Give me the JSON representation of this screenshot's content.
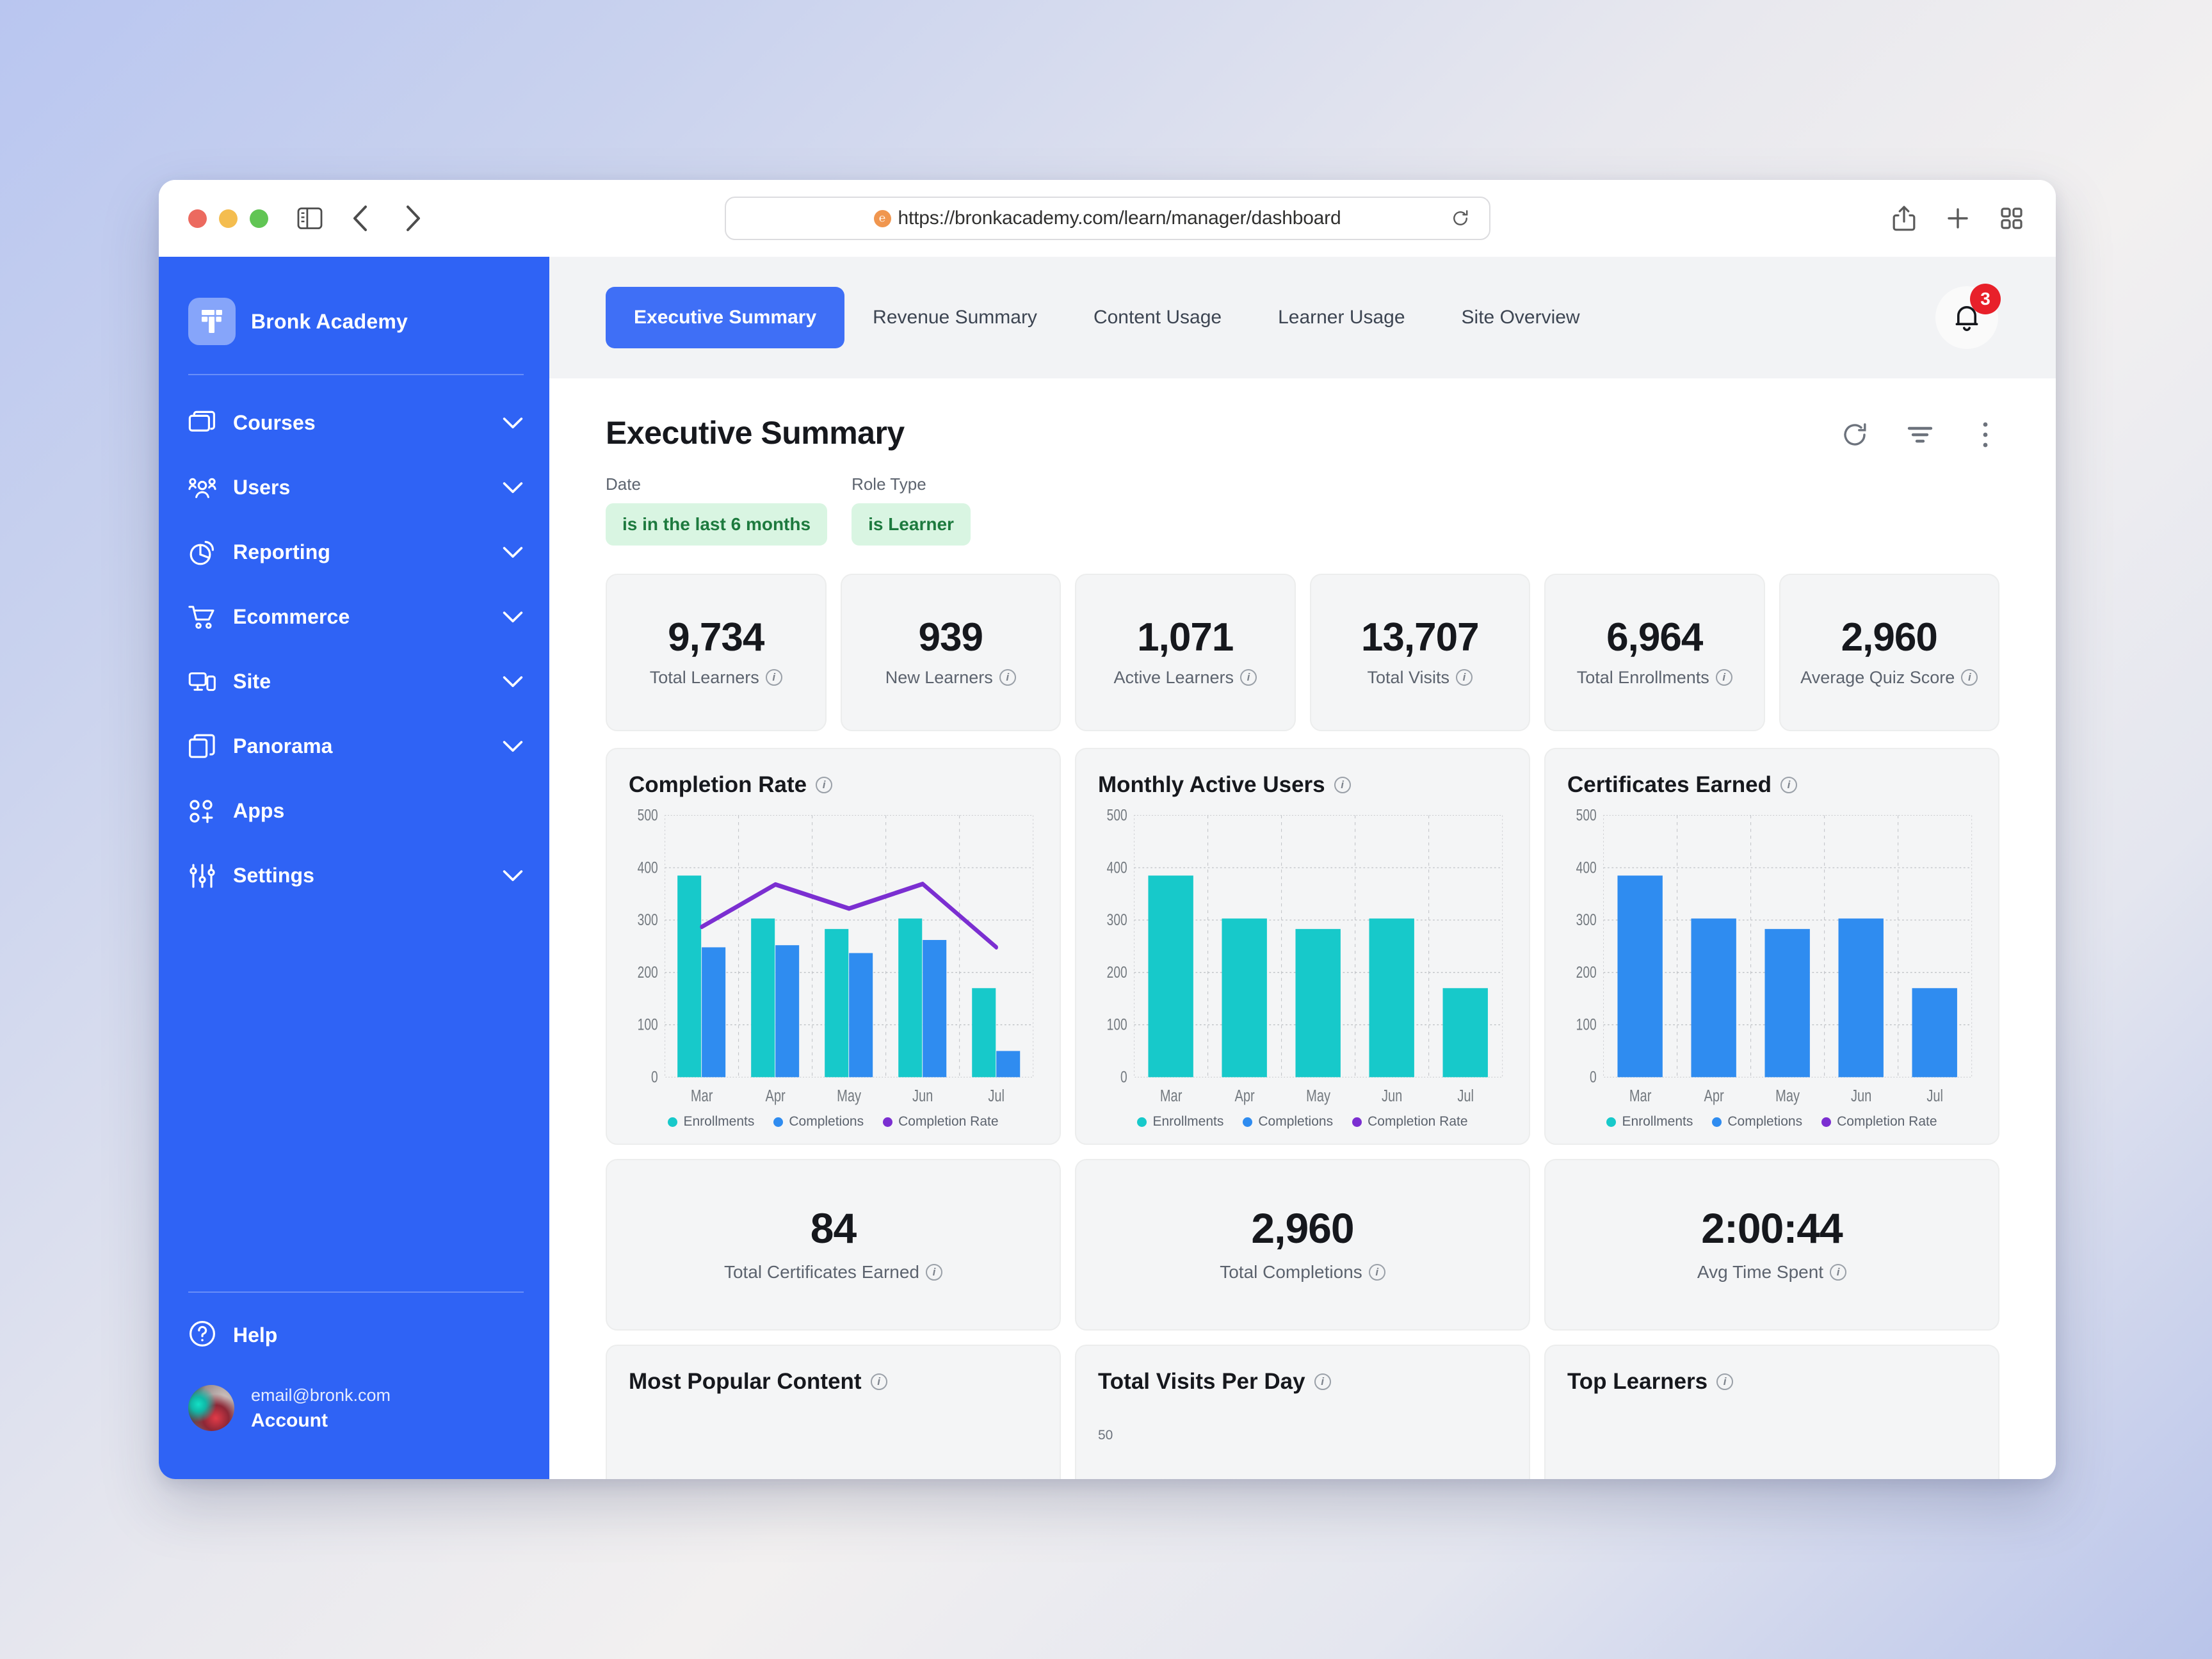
{
  "browser": {
    "url": "https://bronkacademy.com/learn/manager/dashboard",
    "favicon_icon": "orange-circle-favicon",
    "back_icon": "chevron-left-icon",
    "forward_icon": "chevron-right-icon",
    "sidebar_toggle_icon": "sidebar-toggle-icon",
    "reload_icon": "reload-icon",
    "share_icon": "share-icon",
    "new_tab_icon": "plus-icon",
    "tab_overview_icon": "grid-icon"
  },
  "sidebar": {
    "brand": "Bronk Academy",
    "brand_logo_icon": "bronk-logo-icon",
    "items": [
      {
        "label": "Courses",
        "icon": "courses-icon",
        "chevron": true
      },
      {
        "label": "Users",
        "icon": "users-icon",
        "chevron": true
      },
      {
        "label": "Reporting",
        "icon": "reporting-icon",
        "chevron": true
      },
      {
        "label": "Ecommerce",
        "icon": "cart-icon",
        "chevron": true
      },
      {
        "label": "Site",
        "icon": "site-icon",
        "chevron": true
      },
      {
        "label": "Panorama",
        "icon": "panorama-icon",
        "chevron": true
      },
      {
        "label": "Apps",
        "icon": "apps-icon",
        "chevron": false
      },
      {
        "label": "Settings",
        "icon": "settings-icon",
        "chevron": true
      }
    ],
    "help": {
      "label": "Help",
      "icon": "help-circle-icon"
    },
    "account": {
      "email": "email@bronk.com",
      "name": "Account",
      "avatar_icon": "user-avatar"
    }
  },
  "tabs": [
    {
      "label": "Executive Summary",
      "active": true
    },
    {
      "label": "Revenue Summary",
      "active": false
    },
    {
      "label": "Content Usage",
      "active": false
    },
    {
      "label": "Learner Usage",
      "active": false
    },
    {
      "label": "Site Overview",
      "active": false
    }
  ],
  "notifications": {
    "count": "3",
    "icon": "bell-icon"
  },
  "page": {
    "title": "Executive Summary",
    "actions": [
      {
        "name": "refresh-button",
        "icon": "refresh-icon"
      },
      {
        "name": "filter-button",
        "icon": "filter-icon"
      },
      {
        "name": "more-options-button",
        "icon": "kebab-menu-icon"
      }
    ]
  },
  "filters": [
    {
      "label": "Date",
      "value": "is in the last 6 months"
    },
    {
      "label": "Role Type",
      "value": "is Learner"
    }
  ],
  "kpis": [
    {
      "value": "9,734",
      "label": "Total Learners"
    },
    {
      "value": "939",
      "label": "New Learners"
    },
    {
      "value": "1,071",
      "label": "Active Learners"
    },
    {
      "value": "13,707",
      "label": "Total Visits"
    },
    {
      "value": "6,964",
      "label": "Total Enrollments"
    },
    {
      "value": "2,960",
      "label": "Average Quiz Score"
    }
  ],
  "kpis2": [
    {
      "value": "84",
      "label": "Total Certificates Earned"
    },
    {
      "value": "2,960",
      "label": "Total Completions"
    },
    {
      "value": "2:00:44",
      "label": "Avg Time Spent"
    }
  ],
  "panels": [
    {
      "title": "Most Popular Content",
      "axis_tick": ""
    },
    {
      "title": "Total Visits Per Day",
      "axis_tick": "50"
    },
    {
      "title": "Top Learners",
      "axis_tick": ""
    }
  ],
  "colors": {
    "brand_blue": "#2f63f5",
    "tab_active": "#3f6ff6",
    "enrollments": "#17c9ca",
    "completions": "#2f8cf0",
    "completion_rate": "#7b2fd1",
    "filter_pill_bg": "#d9f5e2",
    "filter_pill_text": "#1d7a3e",
    "badge_red": "#e8202a"
  },
  "chart_data": [
    {
      "type": "bar",
      "title": "Completion Rate",
      "categories": [
        "Mar",
        "Apr",
        "May",
        "Jun",
        "Jul"
      ],
      "xlabel": "",
      "ylabel": "",
      "ylim": [
        0,
        500
      ],
      "yticks": [
        0,
        100,
        200,
        300,
        400,
        500
      ],
      "grid": true,
      "legend_position": "bottom",
      "legend": [
        "Enrollments",
        "Completions",
        "Completion Rate"
      ],
      "series": [
        {
          "name": "Enrollments",
          "kind": "bar",
          "color": "#17c9ca",
          "values": [
            385,
            303,
            283,
            303,
            170
          ]
        },
        {
          "name": "Completions",
          "kind": "bar",
          "color": "#2f8cf0",
          "values": [
            248,
            252,
            237,
            262,
            50
          ]
        },
        {
          "name": "Completion Rate",
          "kind": "line",
          "color": "#7b2fd1",
          "values": [
            287,
            368,
            322,
            369,
            248
          ]
        }
      ]
    },
    {
      "type": "bar",
      "title": "Monthly Active Users",
      "categories": [
        "Mar",
        "Apr",
        "May",
        "Jun",
        "Jul"
      ],
      "xlabel": "",
      "ylabel": "",
      "ylim": [
        0,
        500
      ],
      "yticks": [
        0,
        100,
        200,
        300,
        400,
        500
      ],
      "grid": true,
      "legend_position": "bottom",
      "legend": [
        "Enrollments",
        "Completions",
        "Completion Rate"
      ],
      "series": [
        {
          "name": "Enrollments",
          "kind": "bar",
          "color": "#17c9ca",
          "values": [
            385,
            303,
            283,
            303,
            170
          ]
        },
        {
          "name": "Completions",
          "kind": "bar",
          "color": "#2f8cf0",
          "values": []
        },
        {
          "name": "Completion Rate",
          "kind": "line",
          "color": "#7b2fd1",
          "values": []
        }
      ]
    },
    {
      "type": "bar",
      "title": "Certificates Earned",
      "categories": [
        "Mar",
        "Apr",
        "May",
        "Jun",
        "Jul"
      ],
      "xlabel": "",
      "ylabel": "",
      "ylim": [
        0,
        500
      ],
      "yticks": [
        0,
        100,
        200,
        300,
        400,
        500
      ],
      "grid": true,
      "legend_position": "bottom",
      "legend": [
        "Enrollments",
        "Completions",
        "Completion Rate"
      ],
      "series": [
        {
          "name": "Enrollments",
          "kind": "bar",
          "color": "#17c9ca",
          "values": []
        },
        {
          "name": "Completions",
          "kind": "bar",
          "color": "#2f8cf0",
          "values": [
            385,
            303,
            283,
            303,
            170
          ]
        },
        {
          "name": "Completion Rate",
          "kind": "line",
          "color": "#7b2fd1",
          "values": []
        }
      ]
    }
  ]
}
